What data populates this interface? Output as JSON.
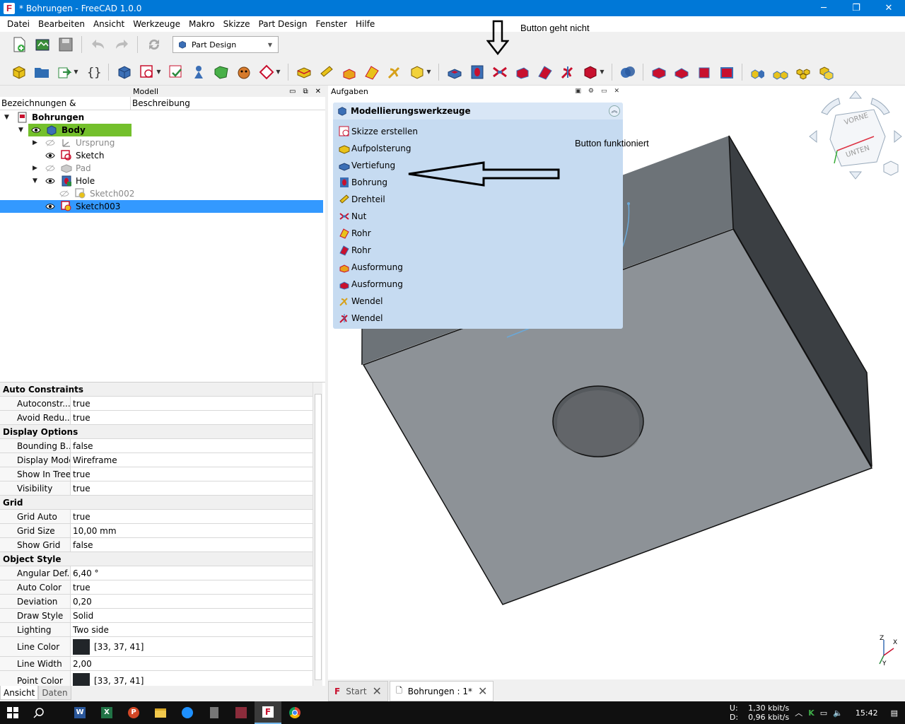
{
  "window": {
    "title": "* Bohrungen - FreeCAD 1.0.0",
    "minimize": "─",
    "maximize": "❐",
    "close": "✕"
  },
  "menu": [
    "Datei",
    "Bearbeiten",
    "Ansicht",
    "Werkzeuge",
    "Makro",
    "Skizze",
    "Part Design",
    "Fenster",
    "Hilfe"
  ],
  "workbench": {
    "selected": "Part Design"
  },
  "model_panel": {
    "title": "Modell",
    "col1": "Bezeichnungen & Eigenschaften",
    "col2": "Beschreibung"
  },
  "tree": [
    {
      "label": "Bohrungen",
      "bold": true
    },
    {
      "label": "Body",
      "bold": true
    },
    {
      "label": "Ursprung",
      "grey": true
    },
    {
      "label": "Sketch"
    },
    {
      "label": "Pad",
      "grey": true
    },
    {
      "label": "Hole"
    },
    {
      "label": "Sketch002",
      "grey": true
    },
    {
      "label": "Sketch003"
    }
  ],
  "properties": [
    {
      "group": "Auto Constraints"
    },
    {
      "name": "Autoconstr...",
      "value": "true"
    },
    {
      "name": "Avoid Redu...",
      "value": "true"
    },
    {
      "group": "Display Options"
    },
    {
      "name": "Bounding B...",
      "value": "false"
    },
    {
      "name": "Display Mode",
      "value": "Wireframe"
    },
    {
      "name": "Show In Tree",
      "value": "true"
    },
    {
      "name": "Visibility",
      "value": "true"
    },
    {
      "group": "Grid"
    },
    {
      "name": "Grid Auto",
      "value": "true"
    },
    {
      "name": "Grid Size",
      "value": "10,00 mm"
    },
    {
      "name": "Show Grid",
      "value": "false"
    },
    {
      "group": "Object Style"
    },
    {
      "name": "Angular Def...",
      "value": "6,40 °"
    },
    {
      "name": "Auto Color",
      "value": "true"
    },
    {
      "name": "Deviation",
      "value": "0,20"
    },
    {
      "name": "Draw Style",
      "value": "Solid"
    },
    {
      "name": "Lighting",
      "value": "Two side"
    },
    {
      "name": "Line Color",
      "value": "[33, 37, 41]",
      "swatch": "#212529"
    },
    {
      "name": "Line Width",
      "value": "2,00"
    },
    {
      "name": "Point Color",
      "value": "[33, 37, 41]",
      "swatch": "#212529"
    }
  ],
  "left_tabs": {
    "view": "Ansicht",
    "data": "Daten"
  },
  "tasks_panel": {
    "title": "Aufgaben",
    "box_title": "Modellierungswerkzeuge"
  },
  "task_items": [
    "Skizze erstellen",
    "Aufpolsterung",
    "Vertiefung",
    "Bohrung",
    "Drehteil",
    "Nut",
    "Rohr",
    "Rohr",
    "Ausformung",
    "Ausformung",
    "Wendel",
    "Wendel"
  ],
  "annotations": {
    "top": "Button geht nicht",
    "side": "Button funktioniert"
  },
  "navcube": {
    "front": "VORNE",
    "bottom": "UNTEN"
  },
  "axes": {
    "z": "Z",
    "x": "X",
    "y": "Y"
  },
  "doc_tabs": {
    "start": "Start",
    "doc": "Bohrungen : 1*"
  },
  "taskbar": {
    "upload_label": "U:",
    "download_label": "D:",
    "upload": "1,30 kbit/s",
    "download": "0,96 kbit/s",
    "time": "15:42"
  },
  "colors": {
    "accent": "#0078d7",
    "selection": "#3399ff",
    "body_highlight": "#74c02c",
    "task_bg": "#c6dbf1",
    "model_gray": "#8c9196"
  }
}
